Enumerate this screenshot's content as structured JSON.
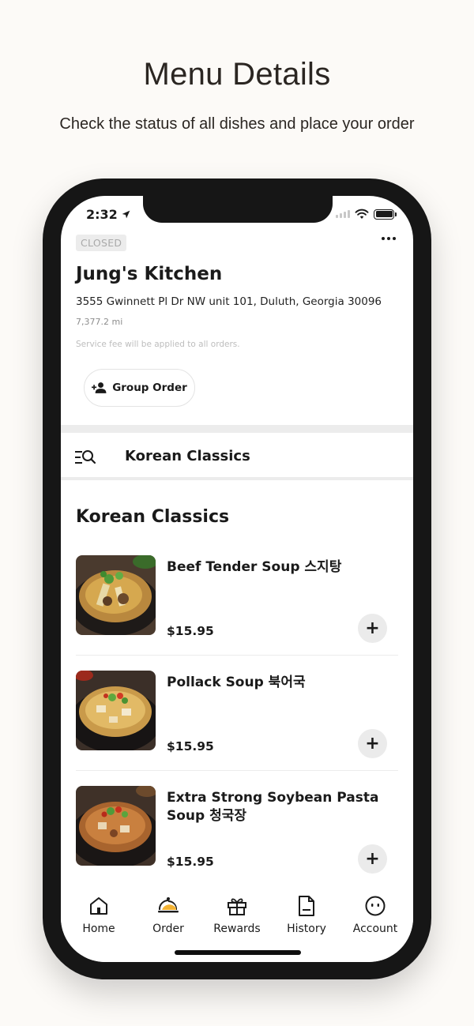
{
  "hero": {
    "title": "Menu Details",
    "subtitle": "Check the status of all dishes and place your order"
  },
  "status_bar": {
    "time": "2:32"
  },
  "restaurant": {
    "status_badge": "CLOSED",
    "name": "Jung's Kitchen",
    "address": "3555 Gwinnett Pl Dr NW unit 101, Duluth, Georgia 30096",
    "distance": "7,377.2 mi",
    "fee_note": "Service fee will be applied to all orders.",
    "group_order_label": "Group Order"
  },
  "tabs": {
    "active": "Korean Classics"
  },
  "section": {
    "title": "Korean Classics"
  },
  "items": [
    {
      "name": "Beef Tender Soup 스지탕",
      "price": "$15.95",
      "add": "+"
    },
    {
      "name": "Pollack Soup 북어국",
      "price": "$15.95",
      "add": "+"
    },
    {
      "name": "Extra Strong Soybean Pasta Soup 청국장",
      "price": "$15.95",
      "add": "+"
    }
  ],
  "nav": [
    {
      "label": "Home",
      "icon": "home-icon"
    },
    {
      "label": "Order",
      "icon": "cloche-icon"
    },
    {
      "label": "Rewards",
      "icon": "gift-icon"
    },
    {
      "label": "History",
      "icon": "document-icon"
    },
    {
      "label": "Account",
      "icon": "account-icon"
    }
  ],
  "colors": {
    "background": "#fcfaf7",
    "accent": "#f2b233",
    "phone_frame": "#161616"
  }
}
